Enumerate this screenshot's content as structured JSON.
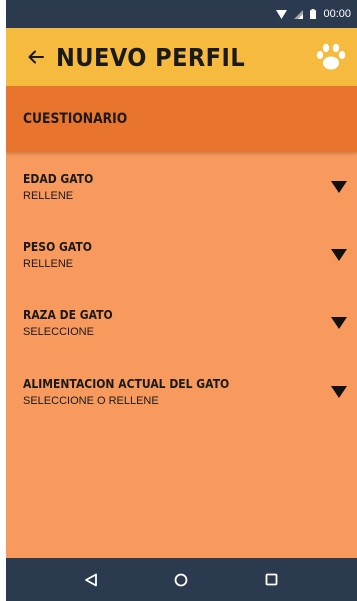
{
  "status_bar": {
    "time": "00:00",
    "icons": [
      "wifi-icon",
      "signal-icon",
      "battery-icon"
    ]
  },
  "app_bar": {
    "title": "Nuevo perfil",
    "back_icon": "arrow-left-icon",
    "action_icon": "paw-icon"
  },
  "section": {
    "title": "Cuestionario"
  },
  "fields": [
    {
      "label": "Edad gato",
      "value": "RELLENE",
      "icon": "dropdown-arrow-icon"
    },
    {
      "label": "Peso gato",
      "value": "RELLENE",
      "icon": "dropdown-arrow-icon"
    },
    {
      "label": "Raza de gato",
      "value": "SELECCIONE",
      "icon": "dropdown-arrow-icon"
    },
    {
      "label": "Alimentacion actual del gato",
      "value": "SELECCIONE O RELLENE",
      "icon": "dropdown-arrow-icon"
    }
  ],
  "nav_bar": {
    "buttons": [
      "back-triangle-icon",
      "home-circle-icon",
      "recents-square-icon"
    ]
  },
  "colors": {
    "status_bar": "#2B3A4E",
    "app_bar": "#F6BA3E",
    "section_header": "#E8742E",
    "background": "#F89A5E",
    "nav_bar": "#2B3A4E"
  }
}
